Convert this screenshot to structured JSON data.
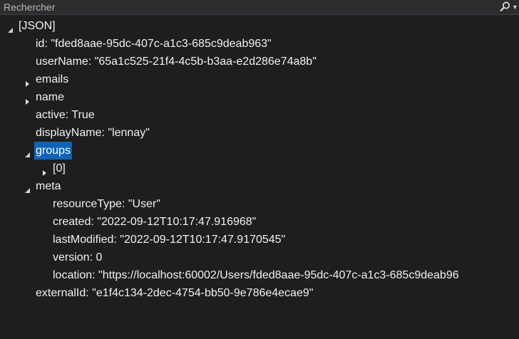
{
  "search": {
    "placeholder": "Rechercher",
    "search_icon": "search-icon",
    "dropdown_icon": "chevron-down-icon"
  },
  "tree": {
    "root": {
      "label": "[JSON]",
      "expanded": true
    },
    "id": "id: \"fded8aae-95dc-407c-a1c3-685c9deab963\"",
    "userName": "userName: \"65a1c525-21f4-4c5b-b3aa-e2d286e74a8b\"",
    "emails": {
      "label": "emails",
      "expanded": false
    },
    "name": {
      "label": "name",
      "expanded": false
    },
    "active": "active: True",
    "displayName": "displayName: \"lennay\"",
    "groups": {
      "label": "groups",
      "expanded": true,
      "selected": true
    },
    "groups_item_0": {
      "label": "[0]",
      "expanded": false
    },
    "meta": {
      "label": "meta",
      "expanded": true
    },
    "meta_resourceType": "resourceType: \"User\"",
    "meta_created": "created: \"2022-09-12T10:17:47.916968\"",
    "meta_lastModified": "lastModified: \"2022-09-12T10:17:47.9170545\"",
    "meta_version": "version: 0",
    "meta_location": "location: \"https://localhost:60002/Users/fded8aae-95dc-407c-a1c3-685c9deab96",
    "externalId": "externalId: \"e1f4c134-2dec-4754-bb50-9e786e4ecae9\""
  },
  "colors": {
    "background": "#1e1e1e",
    "selection": "#0e63b8",
    "text": "#f1f1f1"
  }
}
